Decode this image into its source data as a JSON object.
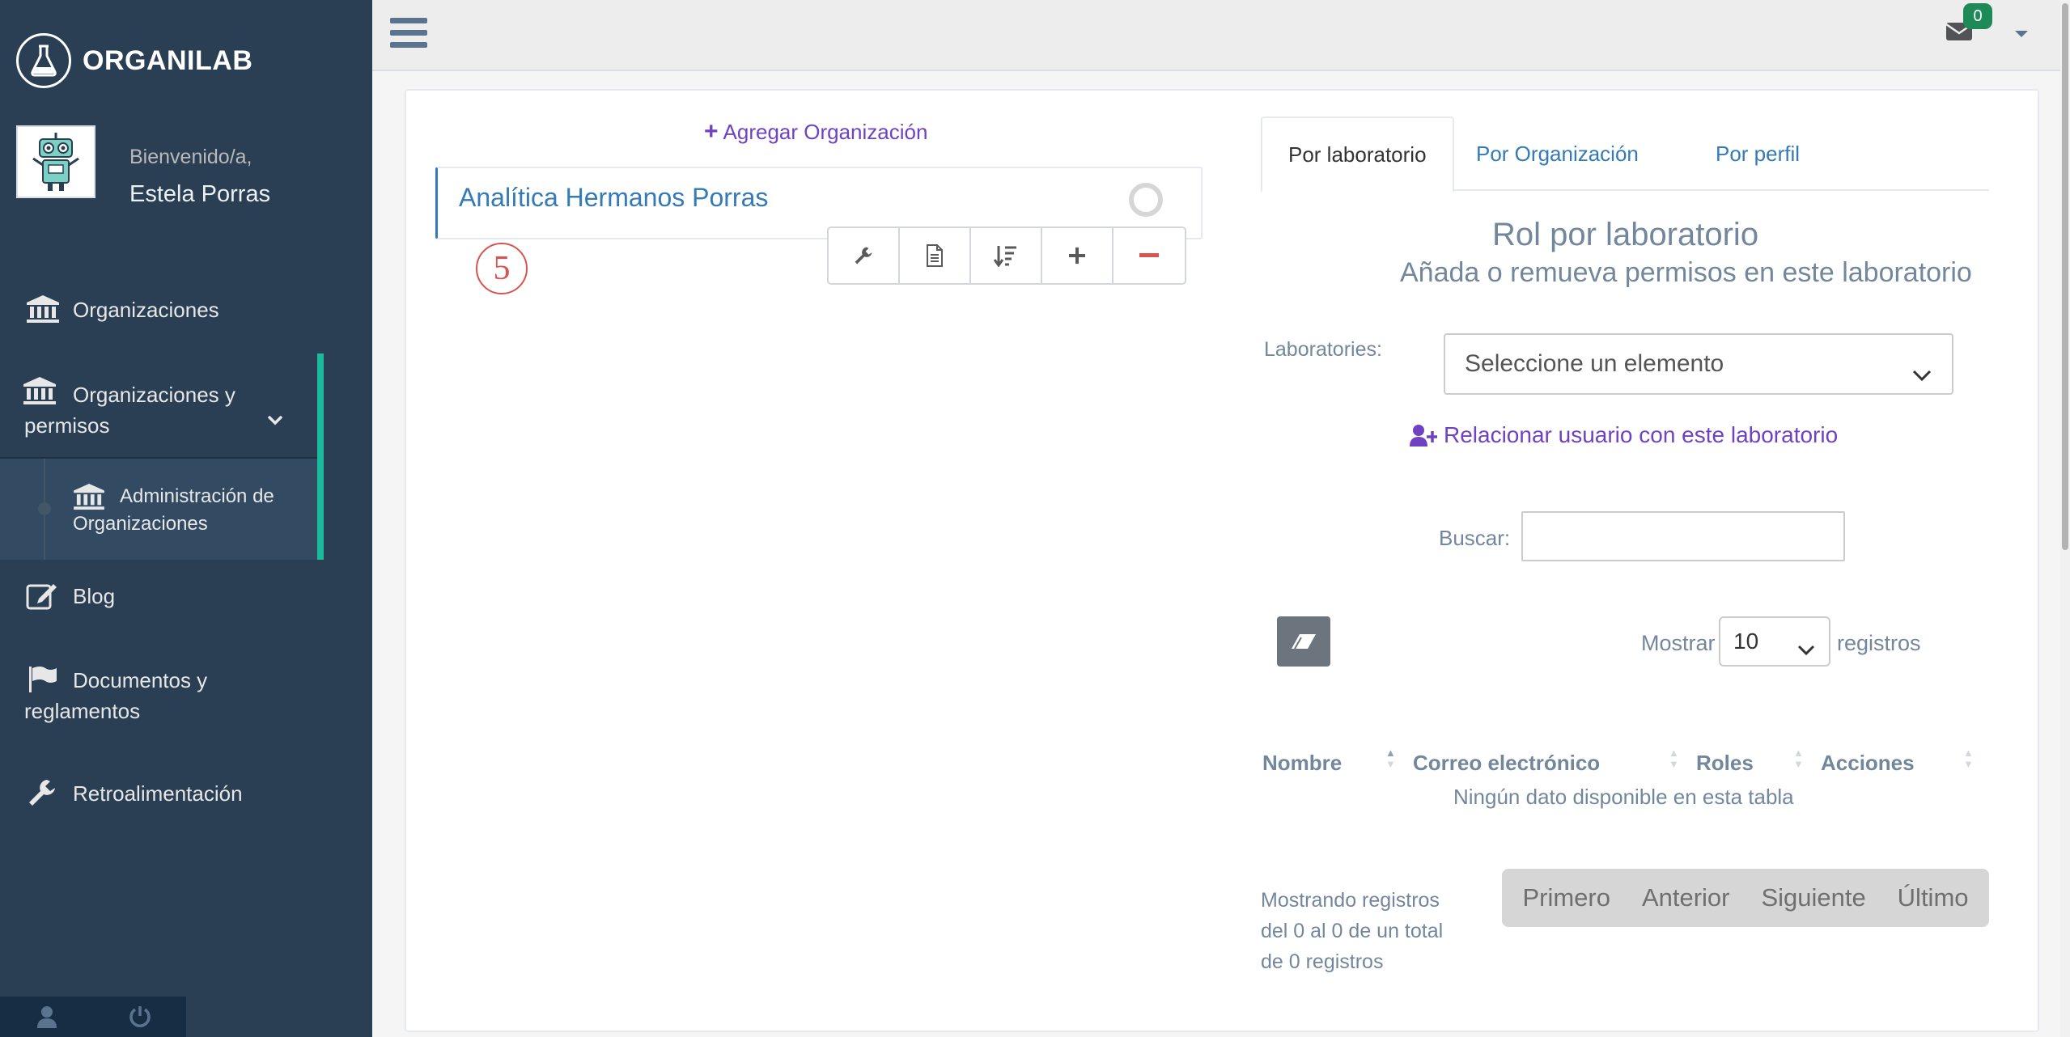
{
  "app": {
    "brand": "ORGANILAB",
    "welcome": "Bienvenido/a,",
    "username": "Estela Porras"
  },
  "sidebar": {
    "items": [
      {
        "label": "Organizaciones",
        "icon": "bank-icon"
      },
      {
        "label": "Organizaciones y permisos",
        "icon": "bank-icon"
      },
      {
        "label": "Administración de Organizaciones",
        "icon": "bank-icon"
      },
      {
        "label": "Blog",
        "icon": "edit-icon"
      },
      {
        "label": "Documentos y reglamentos",
        "icon": "flag-icon"
      },
      {
        "label": "Retroalimentación",
        "icon": "wrench-icon"
      }
    ],
    "footer": [
      "user-icon",
      "power-icon"
    ]
  },
  "topnav": {
    "mail_count": "0"
  },
  "organizations": {
    "add_label": "Agregar Organización",
    "items": [
      {
        "name": "Analítica Hermanos Porras"
      }
    ],
    "stamp": "5"
  },
  "tabs": [
    {
      "label": "Por laboratorio",
      "active": true
    },
    {
      "label": "Por Organización",
      "active": false
    },
    {
      "label": "Por perfil",
      "active": false
    }
  ],
  "section": {
    "title": "Rol por laboratorio",
    "subtitle": "Añada o remueva permisos en este laboratorio",
    "lab_label": "Laboratories:",
    "lab_placeholder": "Seleccione un elemento",
    "relate_label": "Relacionar usuario con este laboratorio"
  },
  "table": {
    "search_label": "Buscar:",
    "show_label": "Mostrar",
    "page_size": "10",
    "records_label": "registros",
    "columns": [
      "Nombre",
      "Correo electrónico",
      "Roles",
      "Acciones"
    ],
    "empty": "Ningún dato disponible en esta tabla",
    "info": "Mostrando registros del 0 al 0 de un total de 0 registros",
    "pager": [
      "Primero",
      "Anterior",
      "Siguiente",
      "Último"
    ]
  },
  "colors": {
    "sidebar": "#2a3f54",
    "accent": "#1abb9c",
    "link": "#337ab7",
    "purple": "#6f42c1",
    "badge": "#1e8a57"
  }
}
